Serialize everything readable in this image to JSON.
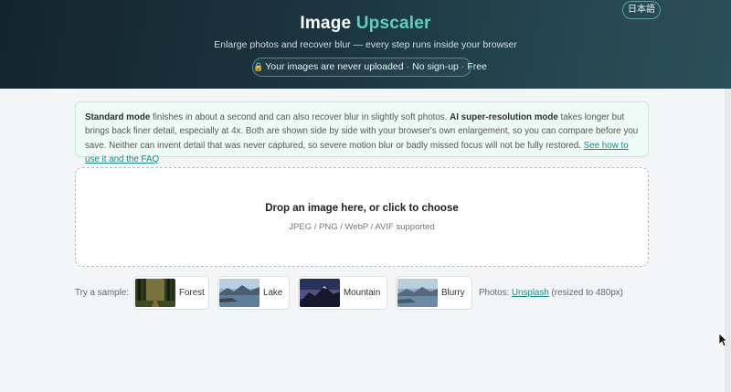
{
  "header": {
    "language_button": "日本語",
    "title_main": "Image ",
    "title_accent": "Upscaler",
    "subtitle": "Enlarge photos and recover blur — every step runs inside your browser",
    "privacy": {
      "lock_icon": "lock-icon",
      "uploaded": "Your images are never uploaded",
      "separator": "·",
      "signup": "No sign-up",
      "free": "Free"
    }
  },
  "notice": {
    "standard_title": "Standard mode",
    "standard_text": " finishes in about a second and can also recover blur in slightly soft photos. ",
    "ai_title": "AI super-resolution mode",
    "ai_text": " takes longer but brings back finer detail, especially at 4x. Both are shown side by side with your browser's own enlargement, so you can compare before you save. Neither can invent detail that was never captured, so severe motion blur or badly missed focus will not be fully restored. ",
    "link": "See how to use it and the FAQ"
  },
  "dropzone": {
    "title": "Drop an image here, or click to choose",
    "formats": "JPEG / PNG / WebP / AVIF supported"
  },
  "samples": {
    "label": "Try a sample:",
    "items": [
      {
        "label": "Forest",
        "icon": "forest-thumbnail"
      },
      {
        "label": "Lake",
        "icon": "lake-thumbnail"
      },
      {
        "label": "Mountain",
        "icon": "mountain-thumbnail"
      },
      {
        "label": "Blurry",
        "icon": "blurry-thumbnail"
      }
    ]
  },
  "credit": {
    "prefix": "Photos: ",
    "link": "Unsplash",
    "suffix": " (resized to 480px)"
  },
  "colors": {
    "accent": "#57d3c6",
    "link": "#1a8e82",
    "header_dark": "#14242d",
    "notice_bg": "#eefbf7"
  }
}
